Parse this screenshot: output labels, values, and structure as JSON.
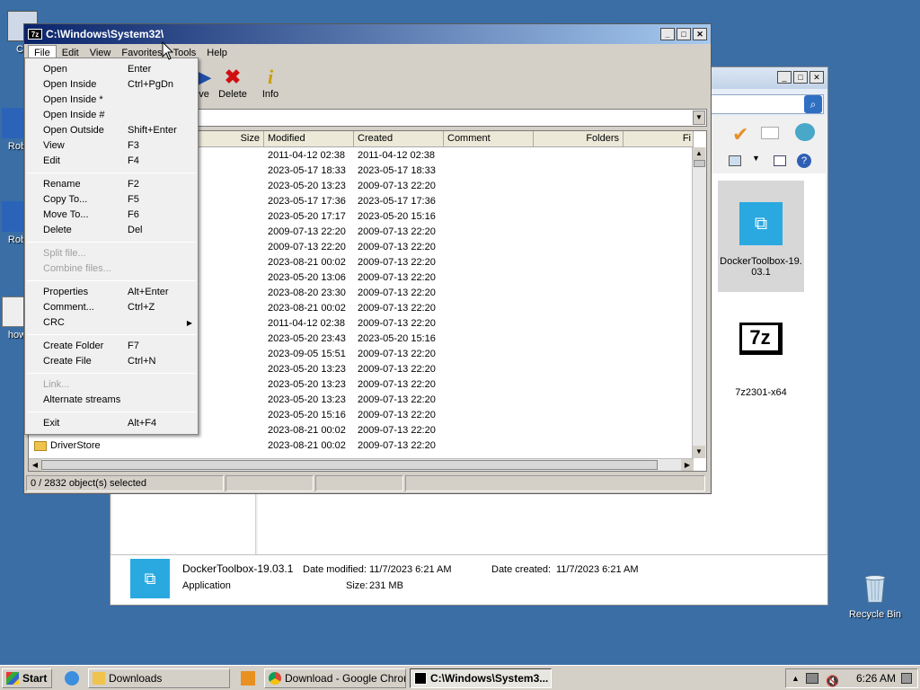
{
  "desktop": {
    "icons": [
      {
        "label": "Co"
      },
      {
        "label": "Rob"
      },
      {
        "label": "Rob"
      },
      {
        "label": "how"
      },
      {
        "label": "Recycle Bin"
      }
    ]
  },
  "explorer": {
    "files": [
      {
        "name": "DockerToolbox-19.\n03.1"
      },
      {
        "name": "7z2301-x64"
      }
    ],
    "details": {
      "name": "DockerToolbox-19.03.1",
      "type": "Application",
      "date_modified_label": "Date modified:",
      "date_modified": "11/7/2023 6:21 AM",
      "date_created_label": "Date created:",
      "date_created": "11/7/2023 6:21 AM",
      "size_label": "Size:",
      "size": "231 MB"
    }
  },
  "sevenzip": {
    "title": "C:\\Windows\\System32\\",
    "app_icon": "7z",
    "menu": [
      "File",
      "Edit",
      "View",
      "Favorites",
      "Tools",
      "Help"
    ],
    "toolbar": [
      {
        "label": "ve",
        "icon": "move-icon"
      },
      {
        "label": "Delete",
        "icon": "delete-x-icon"
      },
      {
        "label": "Info",
        "icon": "info-icon"
      }
    ],
    "columns": [
      "Size",
      "Modified",
      "Created",
      "Comment",
      "Folders",
      "Fi"
    ],
    "rows": [
      {
        "name": "",
        "modified": "2011-04-12 02:38",
        "created": "2011-04-12 02:38"
      },
      {
        "name": "",
        "modified": "2023-05-17 18:33",
        "created": "2023-05-17 18:33"
      },
      {
        "name": "",
        "modified": "2023-05-20 13:23",
        "created": "2009-07-13 22:20"
      },
      {
        "name": "",
        "modified": "2023-05-17 17:36",
        "created": "2023-05-17 17:36"
      },
      {
        "name": "",
        "modified": "2023-05-20 17:17",
        "created": "2023-05-20 15:16"
      },
      {
        "name": "",
        "modified": "2009-07-13 22:20",
        "created": "2009-07-13 22:20"
      },
      {
        "name": "",
        "modified": "2009-07-13 22:20",
        "created": "2009-07-13 22:20"
      },
      {
        "name": "",
        "modified": "2023-08-21 00:02",
        "created": "2009-07-13 22:20"
      },
      {
        "name": "",
        "modified": "2023-05-20 13:06",
        "created": "2009-07-13 22:20"
      },
      {
        "name": "",
        "modified": "2023-08-20 23:30",
        "created": "2009-07-13 22:20"
      },
      {
        "name": "",
        "modified": "2023-08-21 00:02",
        "created": "2009-07-13 22:20"
      },
      {
        "name": "",
        "modified": "2011-04-12 02:38",
        "created": "2009-07-13 22:20"
      },
      {
        "name": "",
        "modified": "2023-05-20 23:43",
        "created": "2023-05-20 15:16"
      },
      {
        "name": "",
        "modified": "2023-09-05 15:51",
        "created": "2009-07-13 22:20"
      },
      {
        "name": "",
        "modified": "2023-05-20 13:23",
        "created": "2009-07-13 22:20"
      },
      {
        "name": "",
        "modified": "2023-05-20 13:23",
        "created": "2009-07-13 22:20"
      },
      {
        "name": "",
        "modified": "2023-05-20 13:23",
        "created": "2009-07-13 22:20"
      },
      {
        "name": "",
        "modified": "2023-05-20 15:16",
        "created": "2009-07-13 22:20"
      },
      {
        "name": "",
        "modified": "2023-08-21 00:02",
        "created": "2009-07-13 22:20"
      },
      {
        "name": "DriverStore",
        "modified": "2023-08-21 00:02",
        "created": "2009-07-13 22:20"
      }
    ],
    "status": "0 / 2832 object(s) selected"
  },
  "file_menu": {
    "groups": [
      [
        {
          "label": "Open",
          "shortcut": "Enter"
        },
        {
          "label": "Open Inside",
          "shortcut": "Ctrl+PgDn"
        },
        {
          "label": "Open Inside *",
          "shortcut": ""
        },
        {
          "label": "Open Inside #",
          "shortcut": ""
        },
        {
          "label": "Open Outside",
          "shortcut": "Shift+Enter"
        },
        {
          "label": "View",
          "shortcut": "F3"
        },
        {
          "label": "Edit",
          "shortcut": "F4"
        }
      ],
      [
        {
          "label": "Rename",
          "shortcut": "F2"
        },
        {
          "label": "Copy To...",
          "shortcut": "F5"
        },
        {
          "label": "Move To...",
          "shortcut": "F6"
        },
        {
          "label": "Delete",
          "shortcut": "Del"
        }
      ],
      [
        {
          "label": "Split file...",
          "shortcut": "",
          "disabled": true
        },
        {
          "label": "Combine files...",
          "shortcut": "",
          "disabled": true
        }
      ],
      [
        {
          "label": "Properties",
          "shortcut": "Alt+Enter"
        },
        {
          "label": "Comment...",
          "shortcut": "Ctrl+Z"
        },
        {
          "label": "CRC",
          "shortcut": "",
          "submenu": true
        }
      ],
      [
        {
          "label": "Create Folder",
          "shortcut": "F7"
        },
        {
          "label": "Create File",
          "shortcut": "Ctrl+N"
        }
      ],
      [
        {
          "label": "Link...",
          "shortcut": "",
          "disabled": true
        },
        {
          "label": "Alternate streams",
          "shortcut": ""
        }
      ],
      [
        {
          "label": "Exit",
          "shortcut": "Alt+F4"
        }
      ]
    ]
  },
  "taskbar": {
    "start": "Start",
    "items": [
      {
        "label": "Downloads"
      },
      {
        "label": "Download - Google Chrome"
      },
      {
        "label": "C:\\Windows\\System3..."
      }
    ],
    "clock": "6:26 AM"
  }
}
